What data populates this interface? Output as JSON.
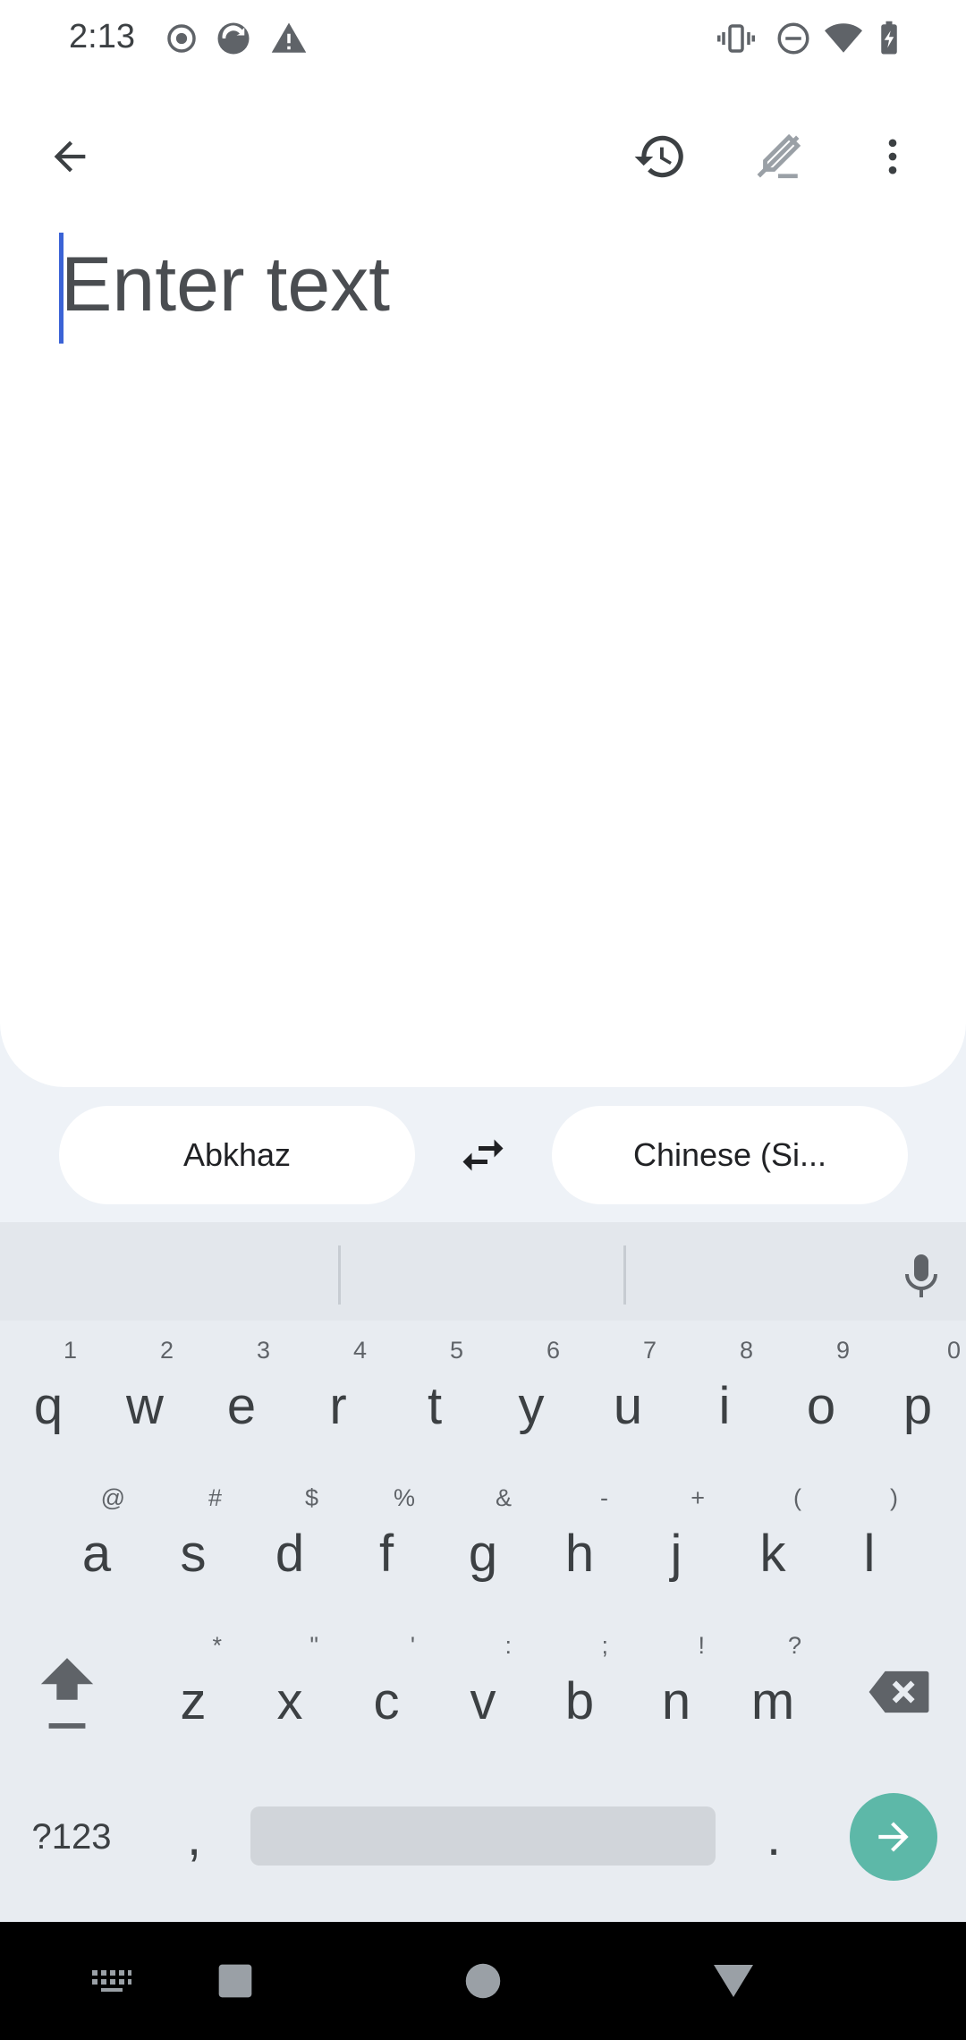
{
  "status_bar": {
    "time": "2:13"
  },
  "text_area": {
    "placeholder": "Enter text"
  },
  "languages": {
    "source": "Abkhaz",
    "target": "Chinese (Si..."
  },
  "keyboard": {
    "row1": [
      {
        "ch": "q",
        "hint": "1"
      },
      {
        "ch": "w",
        "hint": "2"
      },
      {
        "ch": "e",
        "hint": "3"
      },
      {
        "ch": "r",
        "hint": "4"
      },
      {
        "ch": "t",
        "hint": "5"
      },
      {
        "ch": "y",
        "hint": "6"
      },
      {
        "ch": "u",
        "hint": "7"
      },
      {
        "ch": "i",
        "hint": "8"
      },
      {
        "ch": "o",
        "hint": "9"
      },
      {
        "ch": "p",
        "hint": "0"
      }
    ],
    "row2": [
      {
        "ch": "a",
        "hint": "@"
      },
      {
        "ch": "s",
        "hint": "#"
      },
      {
        "ch": "d",
        "hint": "$"
      },
      {
        "ch": "f",
        "hint": "%"
      },
      {
        "ch": "g",
        "hint": "&"
      },
      {
        "ch": "h",
        "hint": "-"
      },
      {
        "ch": "j",
        "hint": "+"
      },
      {
        "ch": "k",
        "hint": "("
      },
      {
        "ch": "l",
        "hint": ")"
      }
    ],
    "row3": [
      {
        "ch": "z",
        "hint": "*"
      },
      {
        "ch": "x",
        "hint": "\""
      },
      {
        "ch": "c",
        "hint": "'"
      },
      {
        "ch": "v",
        "hint": ":"
      },
      {
        "ch": "b",
        "hint": ";"
      },
      {
        "ch": "n",
        "hint": "!"
      },
      {
        "ch": "m",
        "hint": "?"
      }
    ],
    "symbols_label": "?123",
    "comma": ",",
    "period": "."
  },
  "colors": {
    "accent": "#3b63d6",
    "enter": "#5db8a8"
  }
}
